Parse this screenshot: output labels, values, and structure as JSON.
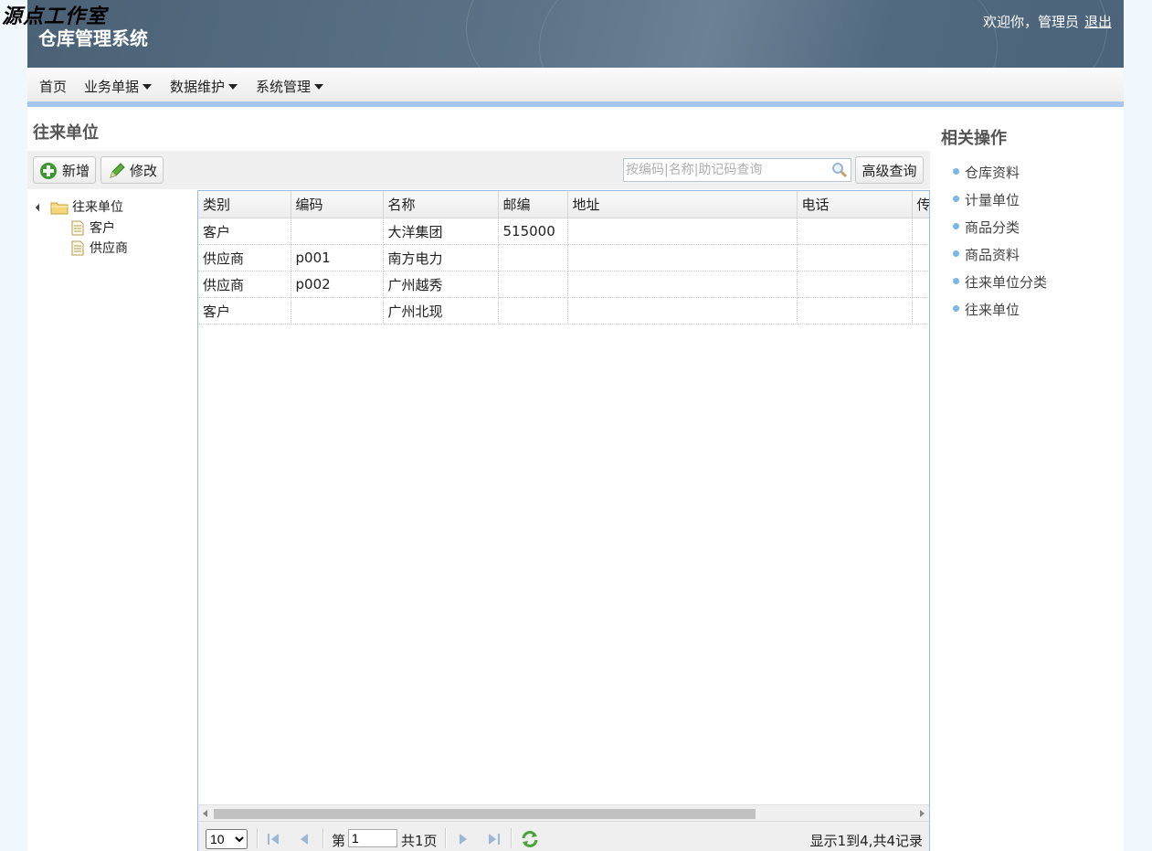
{
  "watermark": "源点工作室",
  "header": {
    "title": "仓库管理系统",
    "welcome": "欢迎你，管理员",
    "logout": "退出"
  },
  "nav": {
    "items": [
      {
        "label": "首页",
        "dropdown": false
      },
      {
        "label": "业务单据",
        "dropdown": true
      },
      {
        "label": "数据维护",
        "dropdown": true
      },
      {
        "label": "系统管理",
        "dropdown": true
      }
    ]
  },
  "page": {
    "title": "往来单位"
  },
  "toolbar": {
    "add_label": "新增",
    "edit_label": "修改",
    "search_placeholder": "按编码|名称|助记码查询",
    "advanced_label": "高级查询"
  },
  "tree": {
    "root": "往来单位",
    "children": [
      "客户",
      "供应商"
    ]
  },
  "grid": {
    "columns": [
      "类别",
      "编码",
      "名称",
      "邮编",
      "地址",
      "电话",
      "传"
    ],
    "rows": [
      [
        "客户",
        "",
        "大洋集团",
        "515000",
        "",
        "",
        ""
      ],
      [
        "供应商",
        "p001",
        "南方电力",
        "",
        "",
        "",
        ""
      ],
      [
        "供应商",
        "p002",
        "广州越秀",
        "",
        "",
        "",
        ""
      ],
      [
        "客户",
        "",
        "广州北现",
        "",
        "",
        "",
        ""
      ]
    ]
  },
  "pager": {
    "page_size": "10",
    "page_prefix": "第",
    "page_value": "1",
    "page_total": "共1页",
    "summary": "显示1到4,共4记录"
  },
  "side": {
    "title": "相关操作",
    "items": [
      "仓库资料",
      "计量单位",
      "商品分类",
      "商品资料",
      "往来单位分类",
      "往来单位"
    ]
  },
  "colors": {
    "header_bg": "#4e667c",
    "accent_bar": "#a6c6ee",
    "grid_border": "#99bbe8",
    "bullet": "#79b7e8"
  }
}
